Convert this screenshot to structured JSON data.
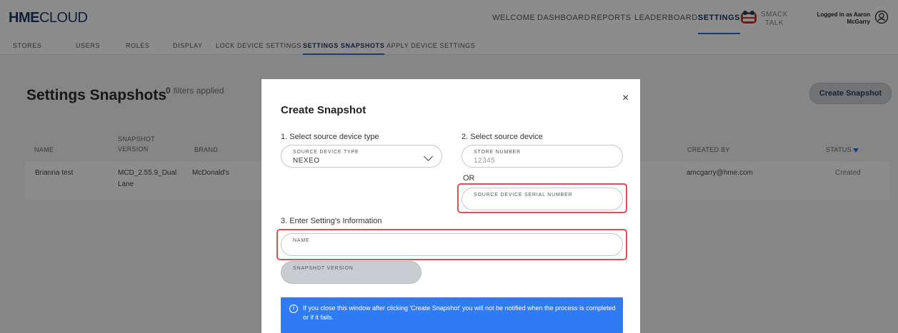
{
  "header": {
    "logo_bold": "HME",
    "logo_light": "CLOUD",
    "nav": [
      "WELCOME",
      "DASHBOARD",
      "REPORTS",
      "LEADERBOARDS",
      "SETTINGS"
    ],
    "smack_talk": "SMACK TALK",
    "logged_in": "Logged in as Aaron McGarry"
  },
  "subnav": [
    "STORES",
    "USERS",
    "ROLES",
    "DISPLAY",
    "LOCK DEVICE SETTINGS",
    "SETTINGS SNAPSHOTS",
    "APPLY DEVICE SETTINGS"
  ],
  "page": {
    "title": "Settings Snapshots",
    "filters_count": "0",
    "filters_text": "filters applied",
    "create_button": "Create Snapshot"
  },
  "table": {
    "headers": {
      "name": "NAME",
      "snapshot_version": "SNAPSHOT VERSION",
      "brand": "BRAND",
      "created_by": "CREATED BY",
      "status": "STATUS"
    },
    "rows": [
      {
        "name": "Brianna test",
        "version": "MCD_2.55.9_Dual Lane",
        "brand": "McDonald's",
        "created_by": "amcgarry@hme.com",
        "status": "Created"
      }
    ]
  },
  "modal": {
    "title": "Create Snapshot",
    "close": "×",
    "step1": "1. Select source device type",
    "step2": "2. Select source device",
    "step3": "3. Enter Setting's Information",
    "device_type_label": "SOURCE DEVICE TYPE",
    "device_type_value": "NEXEO",
    "store_number_label": "STORE NUMBER",
    "store_number_placeholder": "12345",
    "or": "OR",
    "serial_label": "SOURCE DEVICE SERIAL NUMBER",
    "name_label": "NAME",
    "version_label": "SNAPSHOT VERSION",
    "info": "If you close this window after clicking 'Create Snapshot' you will not be notified when the process is completed or if it fails."
  },
  "colors": {
    "brand_navy": "#1d3764",
    "accent_blue": "#2a6cd0",
    "info_blue": "#2f7bf5",
    "highlight_red": "#d9534f"
  }
}
